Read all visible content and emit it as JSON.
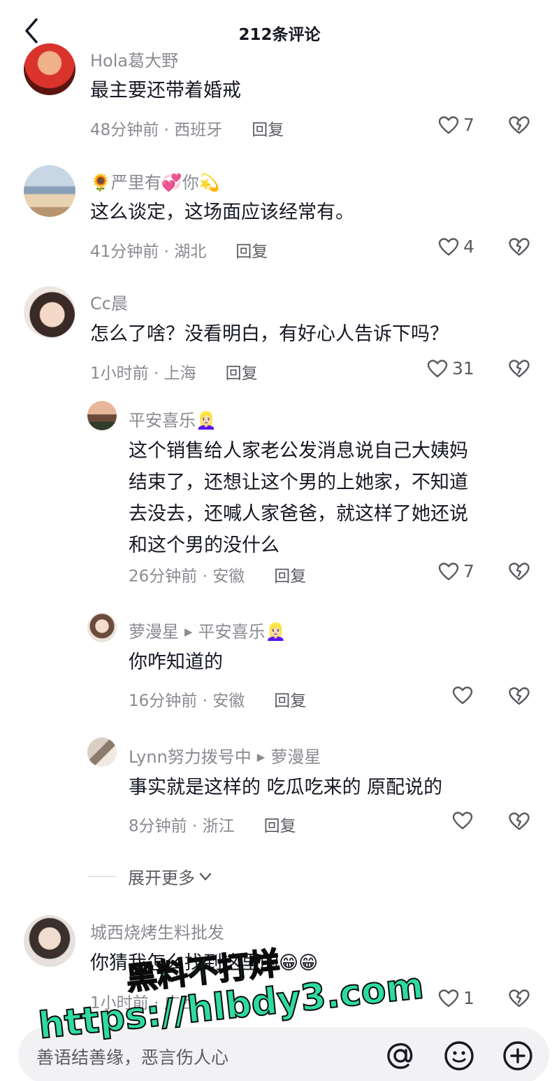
{
  "header": {
    "title": "212条评论"
  },
  "comments": [
    {
      "user": "Hola葛大野",
      "text": "最主要还带着婚戒",
      "time": "48分钟前 · 西班牙",
      "reply": "回复",
      "likes": "7"
    },
    {
      "user": "🌻严里有💞你💫",
      "text": "这么谈定，这场面应该经常有。",
      "time": "41分钟前 · 湖北",
      "reply": "回复",
      "likes": "4"
    },
    {
      "user": "Cc晨",
      "text": "怎么了啥？没看明白，有好心人告诉下吗？",
      "time": "1小时前 · 上海",
      "reply": "回复",
      "likes": "31"
    }
  ],
  "replies": [
    {
      "user": "平安喜乐👱🏻‍♀️",
      "text_lines": [
        "这个销售给人家老公发消息说自己大姨妈",
        "结束了，还想让这个男的上她家，不知道",
        "去没去，还喊人家爸爸，就这样了她还说",
        "和这个男的没什么"
      ],
      "time": "26分钟前 · 安徽",
      "reply": "回复",
      "likes": "7"
    },
    {
      "user": "萝漫星",
      "reply_to": "平安喜乐👱🏻‍♀️",
      "text": "你咋知道的",
      "time": "16分钟前 · 安徽",
      "reply": "回复",
      "likes": ""
    },
    {
      "user": "Lynn努力拨号中",
      "reply_to": "萝漫星",
      "text": "事实就是这样的 吃瓜吃来的 原配说的",
      "time": "8分钟前 · 浙江",
      "reply": "回复",
      "likes": ""
    }
  ],
  "expand": {
    "label": "展开更多"
  },
  "last_comment": {
    "user": "城西烧烤生料批发",
    "text": "你猜我怎么找到这里的😁😁",
    "time": "1小时前 · 广西",
    "likes": "1"
  },
  "input": {
    "placeholder": "善语结善缘，恶言伤人心"
  },
  "watermark": {
    "line1": "黑料不打烊",
    "line2": "https://hlbdy3.com"
  },
  "icons": {
    "back": "back-arrow-icon",
    "like": "heart-icon",
    "dislike": "broken-heart-icon",
    "mention": "at-icon",
    "emoji": "emoji-icon",
    "add": "plus-icon"
  },
  "colors": {
    "text": "#161823",
    "secondary": "#8a8b91",
    "watermark": "#2edba0"
  }
}
